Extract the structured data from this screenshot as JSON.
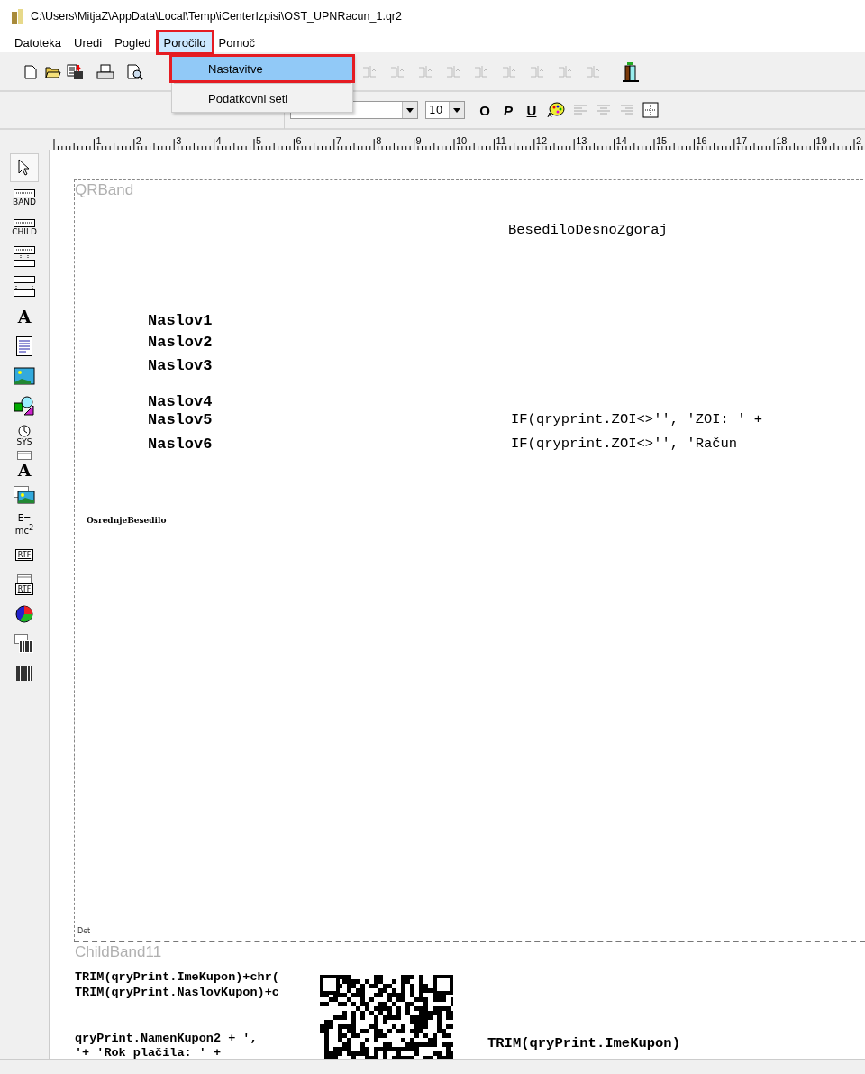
{
  "window": {
    "title": "C:\\Users\\MitjaZ\\AppData\\Local\\Temp\\iCenterIzpisi\\OST_UPNRacun_1.qr2"
  },
  "menu_bar": [
    {
      "label": "Datoteka",
      "selected": false,
      "marked": false
    },
    {
      "label": "Uredi",
      "selected": false,
      "marked": false
    },
    {
      "label": "Pogled",
      "selected": false,
      "marked": false
    },
    {
      "label": "Poročilo",
      "selected": true,
      "marked": true
    },
    {
      "label": "Pomoč",
      "selected": false,
      "marked": false
    }
  ],
  "dropdown_menu": [
    {
      "label": "Nastavitve",
      "selected": true,
      "marked": true
    },
    {
      "label": "Podatkovni seti",
      "selected": false,
      "marked": false
    }
  ],
  "toolbar": [
    {
      "kind": "new",
      "disabled": false
    },
    {
      "kind": "open",
      "disabled": false
    },
    {
      "kind": "save",
      "disabled": false
    },
    {
      "kind": "print",
      "disabled": false
    },
    {
      "kind": "preview",
      "disabled": false
    },
    {
      "kind": "align",
      "disabled": true
    },
    {
      "kind": "align",
      "disabled": true
    },
    {
      "kind": "align",
      "disabled": true
    },
    {
      "kind": "align",
      "disabled": true
    },
    {
      "kind": "align",
      "disabled": true
    },
    {
      "kind": "align",
      "disabled": true
    },
    {
      "kind": "align",
      "disabled": true
    },
    {
      "kind": "align",
      "disabled": true
    },
    {
      "kind": "align",
      "disabled": true
    },
    {
      "kind": "exit",
      "disabled": false
    }
  ],
  "format_bar": {
    "font_size": "10",
    "buttons": [
      {
        "kind": "text",
        "label": "O"
      },
      {
        "kind": "text",
        "label": "P"
      },
      {
        "kind": "text",
        "label": "U"
      },
      {
        "kind": "palette"
      },
      {
        "kind": "align-left"
      },
      {
        "kind": "align-center"
      },
      {
        "kind": "align-right"
      },
      {
        "kind": "frame"
      }
    ]
  },
  "ruler": {
    "labels": [
      "1",
      "2",
      "3",
      "4",
      "5",
      "6",
      "7",
      "8",
      "9",
      "10",
      "11",
      "12",
      "13",
      "14",
      "15",
      "16",
      "17",
      "18",
      "19",
      "2"
    ]
  },
  "palette": [
    {
      "kind": "pointer",
      "selected": true
    },
    {
      "kind": "band",
      "label": "BAND",
      "selected": false
    },
    {
      "kind": "band",
      "label": "CHILD",
      "selected": false
    },
    {
      "kind": "group",
      "selected": false
    },
    {
      "kind": "subdetail",
      "selected": false
    },
    {
      "kind": "letter",
      "label": "A",
      "selected": false
    },
    {
      "kind": "memo",
      "selected": false
    },
    {
      "kind": "image",
      "selected": false
    },
    {
      "kind": "shape",
      "selected": false
    },
    {
      "kind": "sysdata",
      "label": "SYS",
      "selected": false
    },
    {
      "kind": "dbletter",
      "label": "A",
      "selected": false
    },
    {
      "kind": "dbimage",
      "selected": false
    },
    {
      "kind": "expr",
      "label": "E=\nmc$^{2}$",
      "selected": false
    },
    {
      "kind": "rtf",
      "label": "RTF",
      "selected": false
    },
    {
      "kind": "dbrtf",
      "label": "RTF",
      "selected": false
    },
    {
      "kind": "chart",
      "selected": false
    },
    {
      "kind": "dbbarcode",
      "selected": false
    },
    {
      "kind": "barcode",
      "selected": false
    }
  ],
  "canvas": {
    "bands": [
      {
        "label": "QRBand"
      },
      {
        "label": "ChildBand11"
      }
    ],
    "detail_label": "Det",
    "fields": [
      {
        "kind": "plain",
        "text": "BesediloDesnoZgoraj"
      },
      {
        "kind": "heading",
        "text": "Naslov1"
      },
      {
        "kind": "heading",
        "text": "Naslov2"
      },
      {
        "kind": "heading",
        "text": "Naslov3"
      },
      {
        "kind": "heading",
        "text": "Naslov4"
      },
      {
        "kind": "heading",
        "text": "Naslov5"
      },
      {
        "kind": "heading",
        "text": "Naslov6"
      },
      {
        "kind": "plain",
        "text": "IF(qryprint.ZOI<>'', 'ZOI: ' +"
      },
      {
        "kind": "plain",
        "text": "IF(qryprint.ZOI<>'', 'Račun"
      },
      {
        "kind": "tiny",
        "text": "OsrednjeBesedilo"
      },
      {
        "kind": "small",
        "text": "TRIM(qryPrint.ImeKupon)+chr("
      },
      {
        "kind": "small",
        "text": "TRIM(qryPrint.NaslovKupon)+c"
      },
      {
        "kind": "small",
        "text": "qryPrint.NamenKupon2 + ',"
      },
      {
        "kind": "small",
        "text": "'+ 'Rok plačila: ' +"
      },
      {
        "kind": "plain-bold",
        "text": "TRIM(qryPrint.ImeKupon)"
      }
    ]
  }
}
